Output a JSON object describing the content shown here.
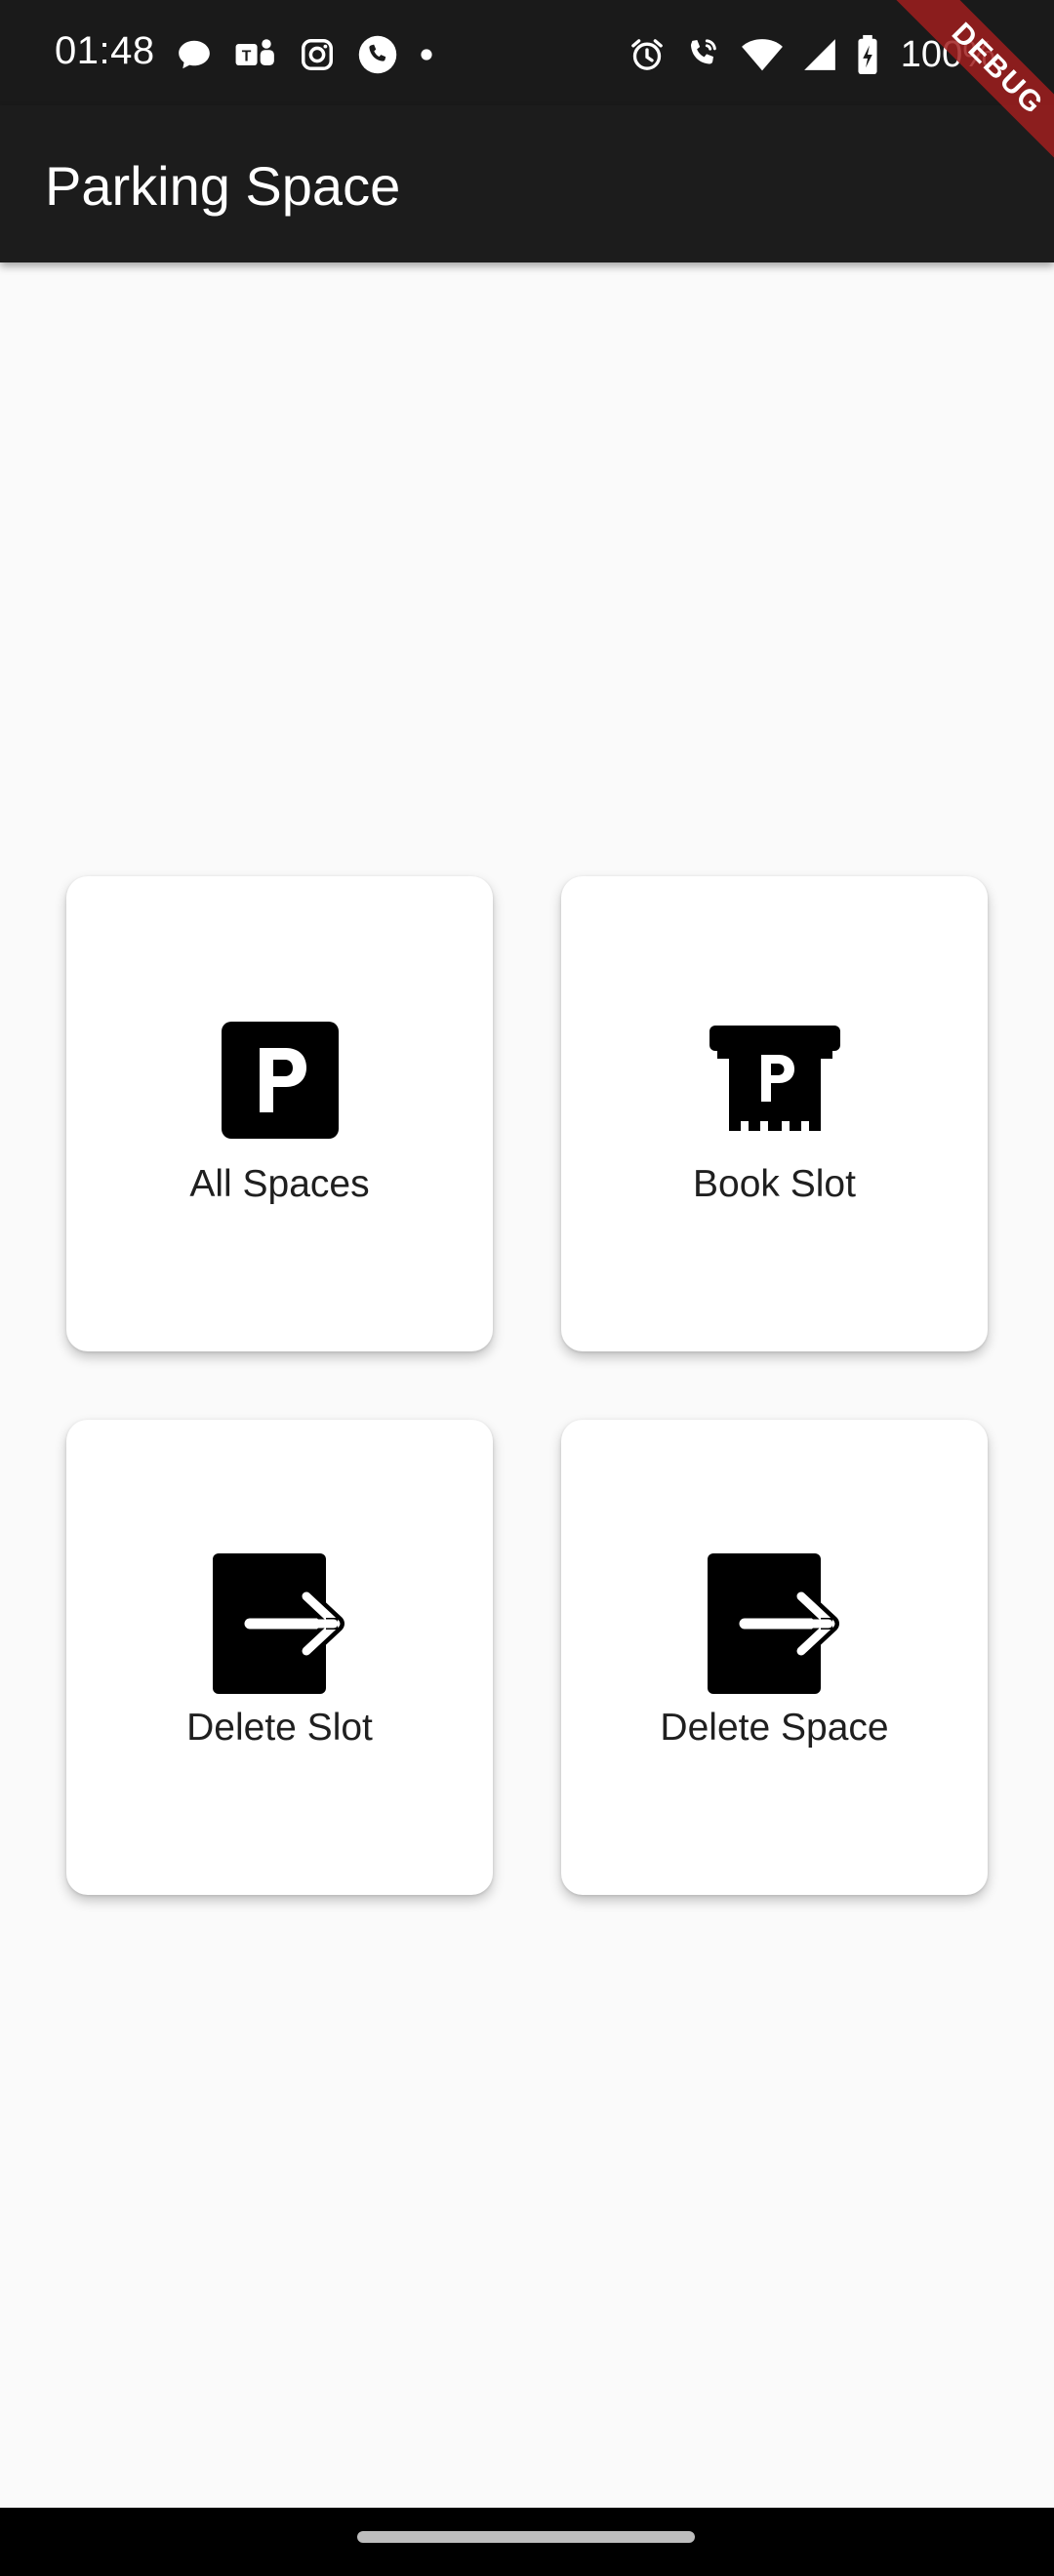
{
  "status_bar": {
    "time": "01:48",
    "battery_text": "100%",
    "left_icons": [
      "chat-bubble-icon",
      "teams-icon",
      "instagram-icon",
      "phone-icon",
      "dot-icon"
    ],
    "right_icons": [
      "alarm-icon",
      "wifi-calling-icon",
      "wifi-icon",
      "signal-icon",
      "battery-charging-icon"
    ]
  },
  "app_bar": {
    "title": "Parking Space"
  },
  "debug_banner": {
    "label": "DEBUG"
  },
  "menu": {
    "items": [
      {
        "label": "All Spaces",
        "icon": "parking-icon"
      },
      {
        "label": "Book Slot",
        "icon": "parking-ticket-icon"
      },
      {
        "label": "Delete Slot",
        "icon": "exit-arrow-icon"
      },
      {
        "label": "Delete Space",
        "icon": "exit-arrow-icon"
      }
    ]
  },
  "colors": {
    "app_bar": "#1c1c1c",
    "status_bar": "#1a1a1a",
    "background": "#fafafa",
    "card": "#ffffff",
    "debug_banner": "#a01e1e"
  }
}
